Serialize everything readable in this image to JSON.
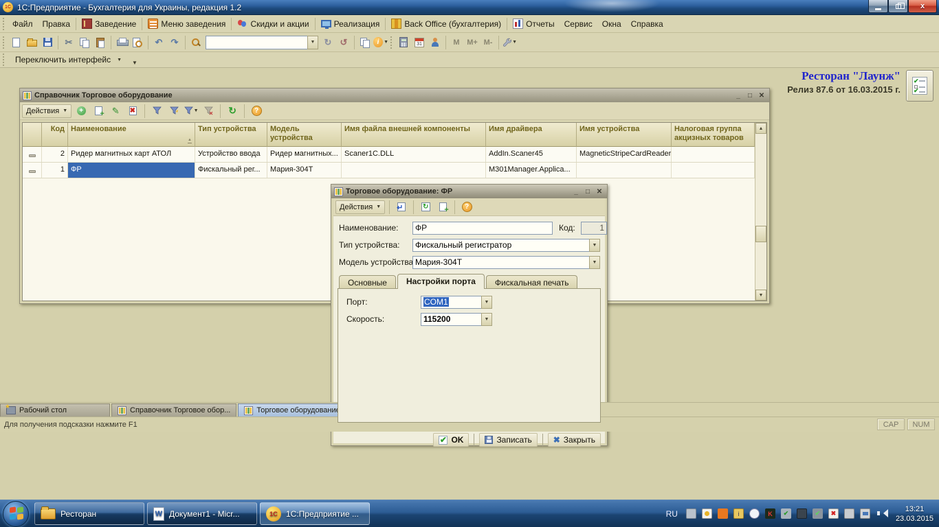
{
  "app": {
    "title": "1С:Предприятие - Бухгалтерия для Украины, редакция 1.2",
    "interface_switcher": "Переключить интерфейс",
    "info_title": "Ресторан \"Лаунж\"",
    "info_release": "Релиз 87.6 от 16.03.2015 г."
  },
  "icons": {
    "one_c": "1С",
    "word_letter": "W",
    "calendar_day": "31",
    "kaspersky_letter": "K"
  },
  "menubar": {
    "items": [
      {
        "label": "Файл"
      },
      {
        "label": "Правка"
      },
      {
        "label": "Заведение"
      },
      {
        "label": "Меню заведения"
      },
      {
        "label": "Скидки и акции"
      },
      {
        "label": "Реализация"
      },
      {
        "label": "Back Office (бухгалтерия)"
      },
      {
        "label": "Отчеты"
      },
      {
        "label": "Сервис"
      },
      {
        "label": "Окна"
      },
      {
        "label": "Справка"
      }
    ]
  },
  "toolbar": {
    "search_value": "",
    "memory": [
      "M",
      "M+",
      "M-"
    ]
  },
  "catalog_window": {
    "title": "Справочник Торговое оборудование",
    "actions_label": "Действия",
    "columns": [
      "Код",
      "Наименование",
      "Тип устройства",
      "Модель устройства",
      "Имя файла внешней компоненты",
      "Имя драйвера",
      "Имя устройства",
      "Налоговая группа акцизных товаров"
    ],
    "rows": [
      {
        "code": "2",
        "name": "Ридер магнитных карт АТОЛ",
        "device_type": "Устройство ввода",
        "model": "Ридер магнитных...",
        "component_file": "Scaner1C.DLL",
        "driver": "AddIn.Scaner45",
        "device_name": "MagneticStripeCardReader",
        "tax_group": ""
      },
      {
        "code": "1",
        "name": "ФР",
        "device_type": "Фискальный рег...",
        "model": "Мария-304Т",
        "component_file": "",
        "driver": "M301Manager.Applica...",
        "device_name": "",
        "tax_group": ""
      }
    ]
  },
  "dialog": {
    "title": "Торговое оборудование: ФР",
    "actions_label": "Действия",
    "name_label": "Наименование:",
    "name_value": "ФР",
    "code_label": "Код:",
    "code_value": "1",
    "type_label": "Тип устройства:",
    "type_value": "Фискальный регистратор",
    "model_label": "Модель устройства:",
    "model_value": "Мария-304Т",
    "tabs": [
      "Основные",
      "Настройки порта",
      "Фискальная печать"
    ],
    "port_label": "Порт:",
    "port_value": "COM1",
    "speed_label": "Скорость:",
    "speed_value": "115200",
    "ok_label": "OK",
    "save_label": "Записать",
    "close_label": "Закрыть"
  },
  "mdi_tabs": [
    {
      "label": "Рабочий стол"
    },
    {
      "label": "Справочник Торговое обор..."
    },
    {
      "label": "Торговое оборудование: ФР"
    }
  ],
  "statusbar": {
    "hint": "Для получения подсказки нажмите F1",
    "cap": "CAP",
    "num": "NUM"
  },
  "taskbar": {
    "apps": [
      {
        "label": "Ресторан"
      },
      {
        "label": "Документ1 - Micr..."
      },
      {
        "label": "1С:Предприятие ..."
      }
    ],
    "lang": "RU",
    "time": "13:21",
    "date": "23.03.2015",
    "tray": [
      "printer",
      "photo-viewer",
      "java",
      "archive",
      "app-badge",
      "kaspersky",
      "card-reader",
      "display-settings",
      "usb-safe-remove",
      "action-center-flag",
      "power",
      "network",
      "volume"
    ]
  }
}
